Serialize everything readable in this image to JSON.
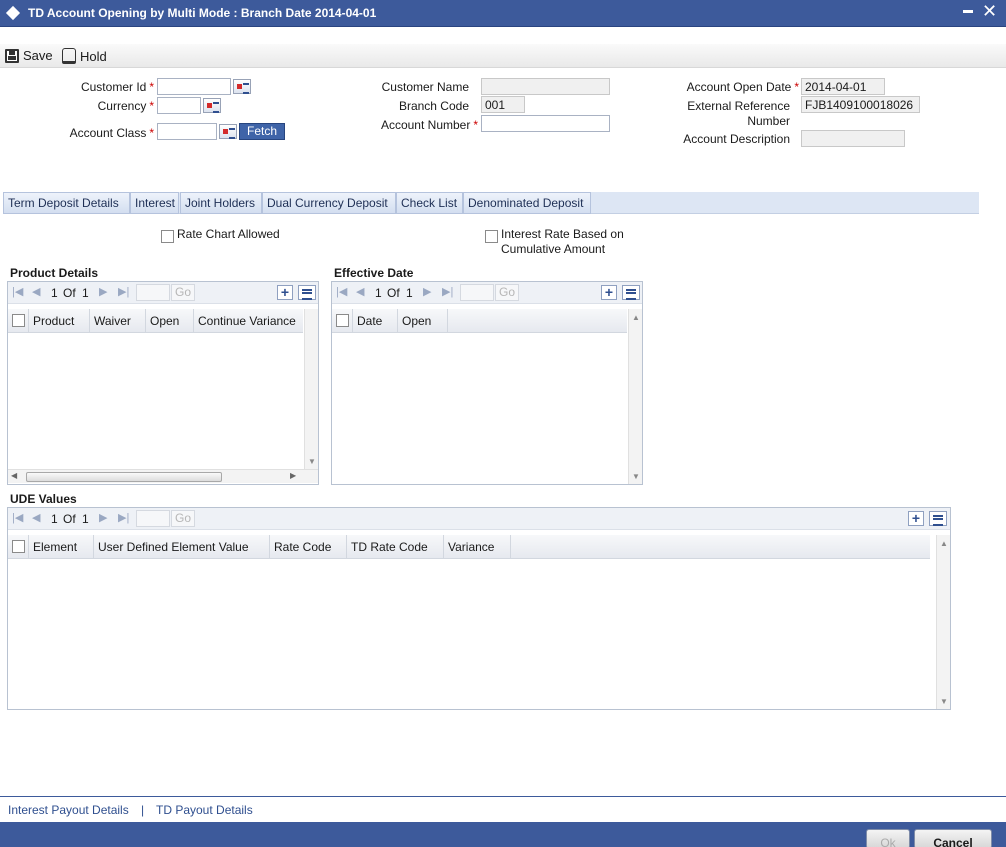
{
  "window": {
    "title": "TD Account Opening by Multi Mode : Branch Date 2014-04-01",
    "minimize_icon": "minimize-icon",
    "close_glyph": "✕"
  },
  "toolbar": {
    "save_label": "Save",
    "hold_label": "Hold"
  },
  "header": {
    "customer_id_label": "Customer Id",
    "customer_id_value": "",
    "currency_label": "Currency",
    "currency_value": "",
    "account_class_label": "Account Class",
    "account_class_value": "",
    "fetch_label": "Fetch",
    "customer_name_label": "Customer Name",
    "customer_name_value": "",
    "branch_code_label": "Branch Code",
    "branch_code_value": "001",
    "account_number_label": "Account Number",
    "account_number_value": "",
    "account_open_date_label": "Account Open Date",
    "account_open_date_value": "2014-04-01",
    "external_reference_label_1": "External Reference",
    "external_reference_label_2": "Number",
    "external_reference_value": "FJB1409100018026",
    "account_description_label": "Account Description",
    "account_description_value": "",
    "required_mark": "*"
  },
  "tabs": [
    "Term Deposit Details",
    "Interest",
    "Joint Holders",
    "Dual Currency Deposit",
    "Check List",
    "Denominated Deposit"
  ],
  "term_deposit": {
    "rate_chart_allowed_label": "Rate Chart Allowed",
    "interest_rate_cumulative_label_1": "Interest Rate Based on",
    "interest_rate_cumulative_label_2": "Cumulative Amount"
  },
  "pager": {
    "current": "1",
    "of_label": "Of",
    "total": "1",
    "go_label": "Go"
  },
  "product_details": {
    "title": "Product Details",
    "columns": [
      "Product",
      "Waiver",
      "Open",
      "Continue Variance"
    ]
  },
  "effective_date": {
    "title": "Effective Date",
    "columns": [
      "Date",
      "Open"
    ]
  },
  "ude_values": {
    "title": "UDE Values",
    "columns": [
      "Element",
      "User Defined Element Value",
      "Rate Code",
      "TD Rate Code",
      "Variance"
    ]
  },
  "footer_links": {
    "interest_payout": "Interest Payout Details",
    "separator": "|",
    "td_payout": "TD Payout Details"
  },
  "buttons": {
    "ok": "Ok",
    "cancel": "Cancel"
  }
}
